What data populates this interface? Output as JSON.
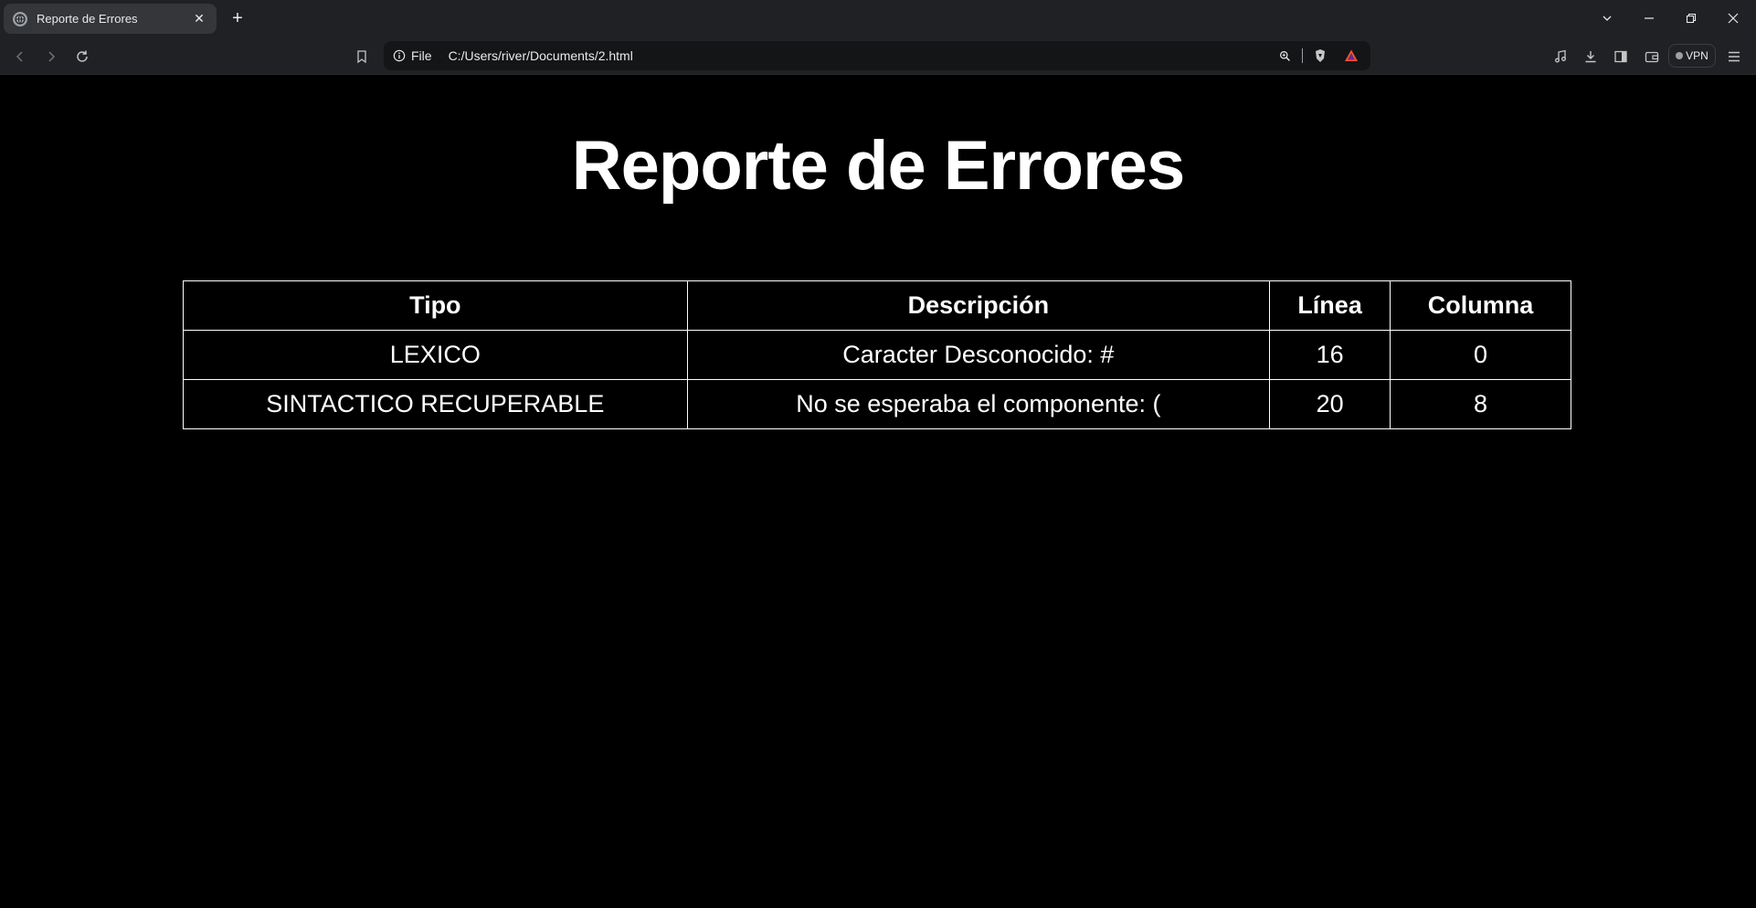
{
  "browser": {
    "tab_title": "Reporte de Errores",
    "address_scheme": "File",
    "address_url": "C:/Users/river/Documents/2.html",
    "vpn_label": "VPN"
  },
  "page": {
    "title": "Reporte de Errores",
    "table": {
      "headers": [
        "Tipo",
        "Descripción",
        "Línea",
        "Columna"
      ],
      "rows": [
        [
          "LEXICO",
          "Caracter Desconocido: #",
          "16",
          "0"
        ],
        [
          "SINTACTICO RECUPERABLE",
          "No se esperaba el componente: (",
          "20",
          "8"
        ]
      ]
    }
  },
  "colors": {
    "background": "#000000",
    "chrome": "#202124",
    "text": "#ffffff"
  }
}
